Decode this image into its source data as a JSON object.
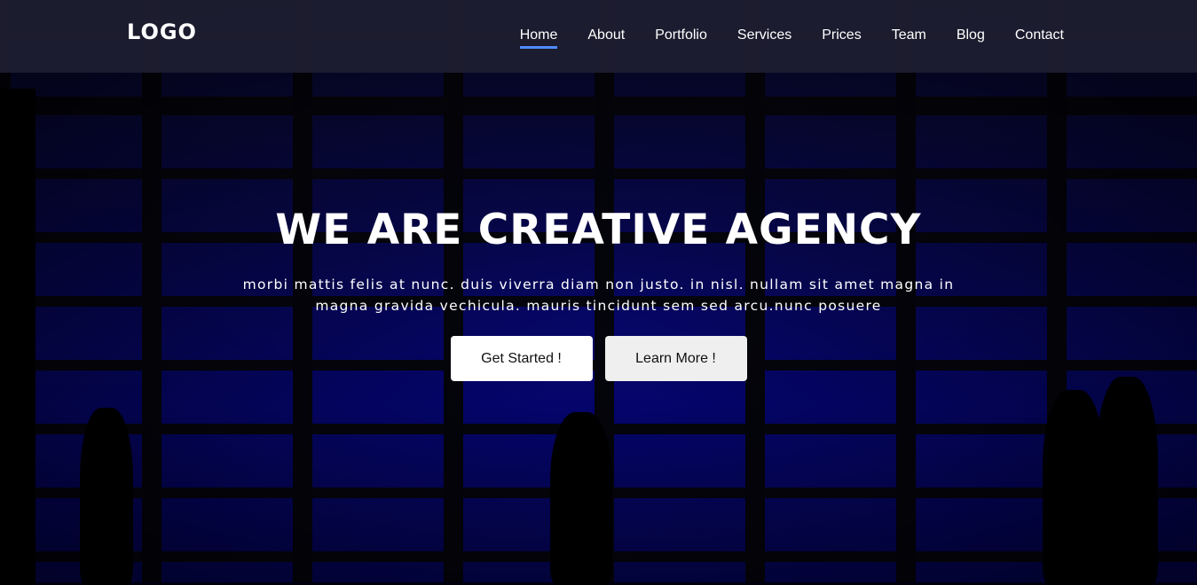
{
  "header": {
    "logo": "LOGO",
    "nav": [
      "Home",
      "About",
      "Portfolio",
      "Services",
      "Prices",
      "Team",
      "Blog",
      "Contact"
    ],
    "active": "Home",
    "accent": "#4f8cff"
  },
  "hero": {
    "title": "WE ARE CREATIVE AGENCY",
    "subtitle": "morbi mattis felis at nunc. duis viverra diam non justo. in nisl. nullam sit amet magna in magna gravida vechicula. mauris tincidunt sem sed arcu.nunc posuere",
    "primary_button": "Get Started !",
    "secondary_button": "Learn More !"
  }
}
